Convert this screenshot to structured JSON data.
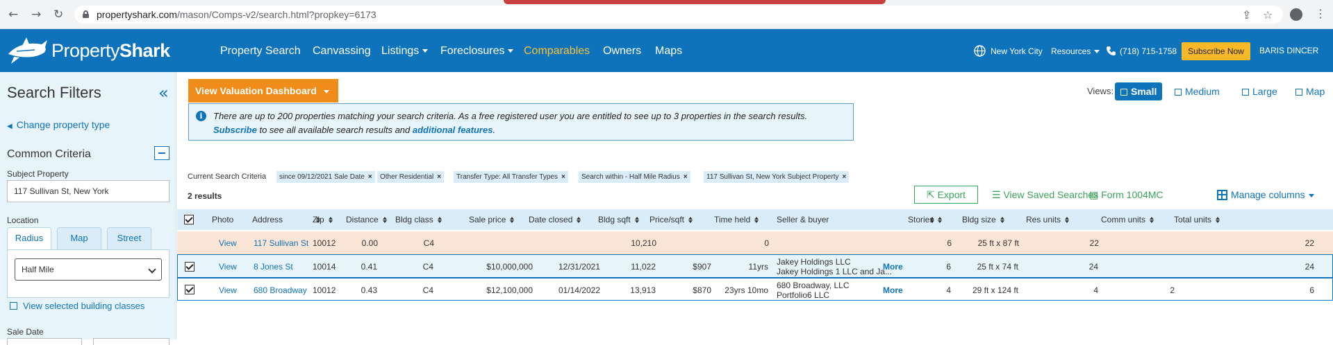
{
  "browser": {
    "url_host": "propertyshark.com",
    "url_path": "/mason/Comps-v2/search.html?propkey=6173"
  },
  "nav": {
    "logo_text_a": "Property",
    "logo_text_b": "Shark",
    "links": [
      "Property Search",
      "Canvassing",
      "Listings",
      "Foreclosures",
      "Comparables",
      "Owners",
      "Maps"
    ],
    "city": "New York City",
    "resources": "Resources",
    "phone": "(718) 715-1758",
    "subscribe": "Subscribe Now",
    "user": "BARIS DINCER"
  },
  "sidebar": {
    "title": "Search Filters",
    "change_type": "Change property type",
    "common_criteria": "Common Criteria",
    "subject_label": "Subject Property",
    "subject_value": "117 Sullivan St, New York",
    "location_label": "Location",
    "tabs": [
      "Radius",
      "Map",
      "Street"
    ],
    "radius_value": "Half Mile",
    "view_classes": "View selected building classes",
    "sale_date_label": "Sale Date"
  },
  "main": {
    "valuation_button": "View Valuation Dashboard",
    "notice_line1": "There are up to 200 properties matching your search criteria. As a free registered user you are entitled to see up to 3 properties in the search results.",
    "notice_subscribe": "Subscribe",
    "notice_mid": " to see all available search results and ",
    "notice_features": "additional features",
    "notice_end": ".",
    "views_label": "Views:",
    "views": [
      "Small",
      "Medium",
      "Large",
      "Map"
    ],
    "criteria_label": "Current Search Criteria",
    "chips": [
      "since 09/12/2021 Sale Date",
      "Other Residential",
      "Transfer Type: All Transfer Types",
      "Search within - Half Mile Radius",
      "117 Sullivan St, New York Subject Property"
    ],
    "results_count": "2 results",
    "export": "Export",
    "view_saved": "View Saved Searches",
    "form": "Form 1004MC",
    "manage_columns": "Manage columns"
  },
  "table": {
    "headers": [
      "Photo",
      "Address",
      "Zip",
      "Distance",
      "Bldg class",
      "Sale price",
      "Date closed",
      "Bldg sqft",
      "Price/sqft",
      "Time held",
      "Seller & buyer",
      "Stories",
      "Bldg size",
      "Res units",
      "Comm units",
      "Total units"
    ],
    "rows": [
      {
        "photo": "View",
        "address": "117 Sullivan St",
        "zip": "10012",
        "distance": "0.00",
        "bldg_class": "C4",
        "sale_price": "",
        "date_closed": "",
        "bldg_sqft": "10,210",
        "price_sqft": "",
        "time_held": "0",
        "seller": "",
        "buyer": "",
        "more": "",
        "stories": "6",
        "bldg_size": "25 ft x 87 ft",
        "res_units": "22",
        "comm_units": "",
        "total_units": "22"
      },
      {
        "photo": "View",
        "address": "8 Jones St",
        "zip": "10014",
        "distance": "0.41",
        "bldg_class": "C4",
        "sale_price": "$10,000,000",
        "date_closed": "12/31/2021",
        "bldg_sqft": "11,022",
        "price_sqft": "$907",
        "time_held": "11yrs",
        "seller": "Jakey Holdings LLC",
        "buyer": "Jakey Holdings 1 LLC and Ja...",
        "more": "More",
        "stories": "6",
        "bldg_size": "25 ft x 74 ft",
        "res_units": "24",
        "comm_units": "",
        "total_units": "24"
      },
      {
        "photo": "View",
        "address": "680 Broadway",
        "zip": "10012",
        "distance": "0.43",
        "bldg_class": "C4",
        "sale_price": "$12,100,000",
        "date_closed": "01/14/2022",
        "bldg_sqft": "13,913",
        "price_sqft": "$870",
        "time_held": "23yrs 10mo",
        "seller": "680 Broadway, LLC",
        "buyer": "Portfolio6 LLC",
        "more": "More",
        "stories": "4",
        "bldg_size": "29 ft x 124 ft",
        "res_units": "4",
        "comm_units": "2",
        "total_units": "6"
      }
    ]
  },
  "colors": {
    "brand_blue": "#0e73bb",
    "accent_orange": "#f08c1a",
    "subscribe_yellow": "#f7b927",
    "active_nav": "#f7c23a",
    "link_green": "#3aa35a"
  }
}
